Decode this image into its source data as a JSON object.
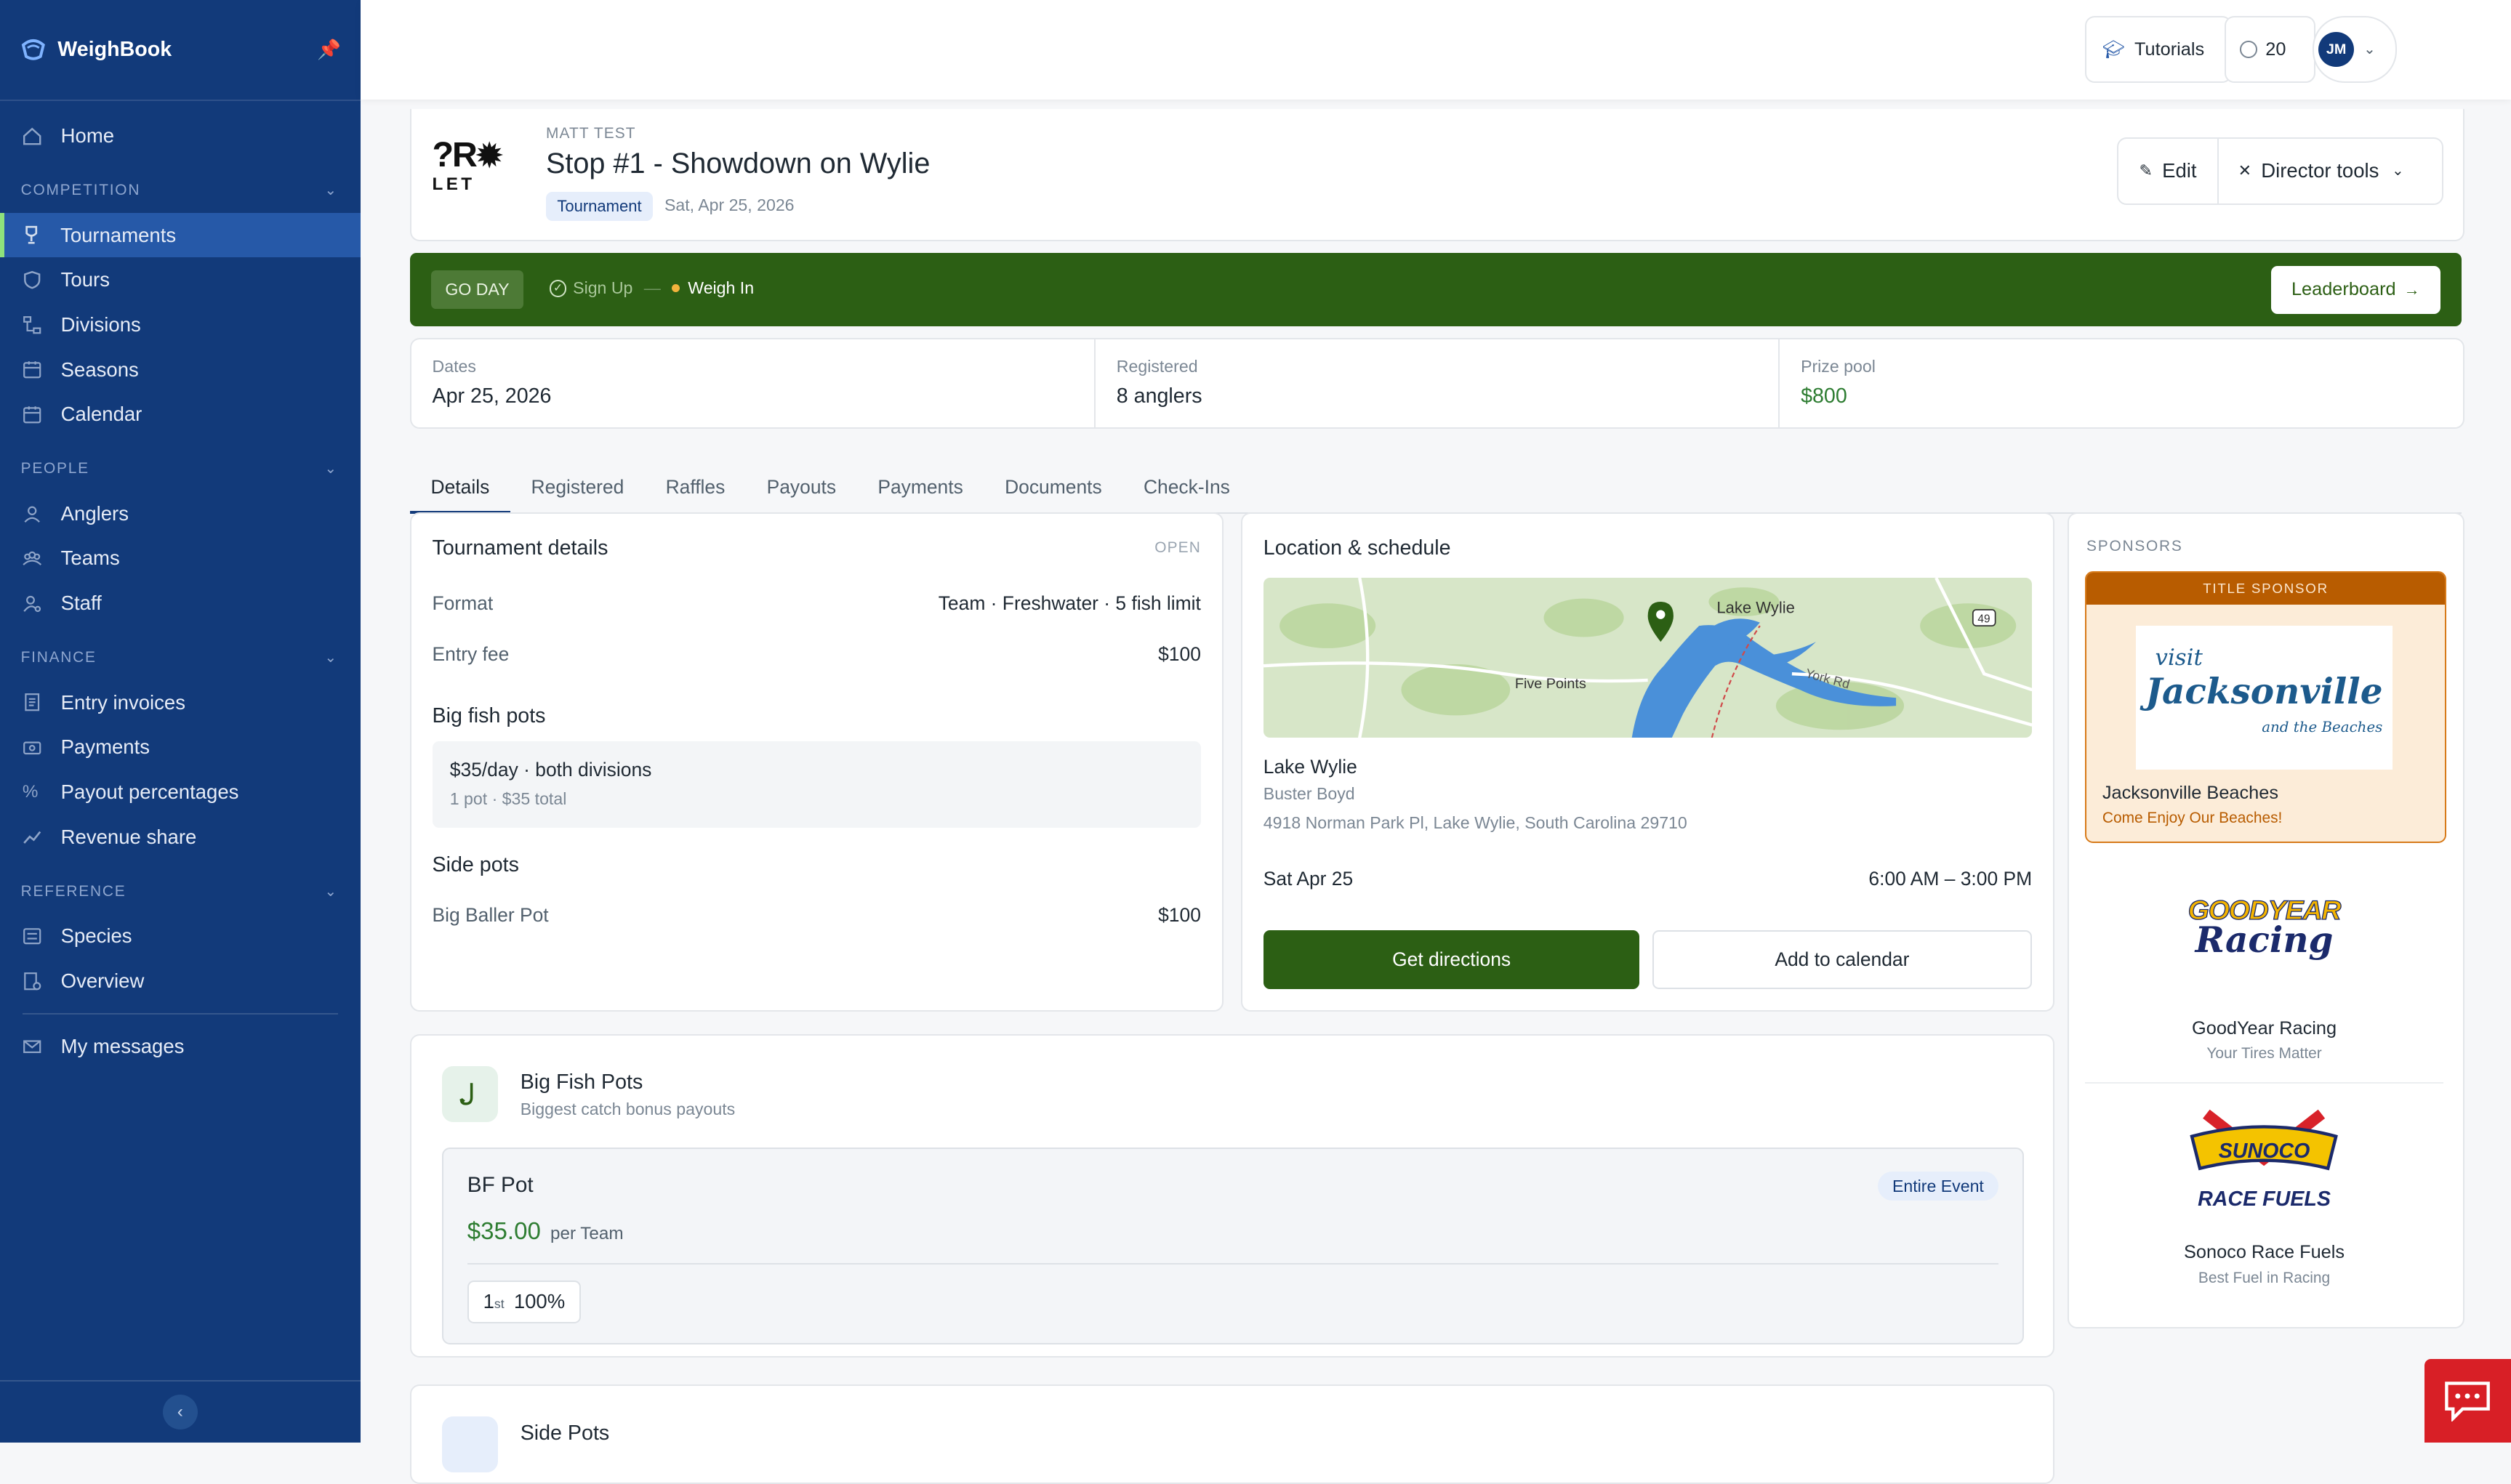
{
  "app": {
    "name": "WeighBook"
  },
  "sidebar": {
    "home": "Home",
    "sections": {
      "competition": "COMPETITION",
      "people": "PEOPLE",
      "finance": "FINANCE",
      "reference": "REFERENCE"
    },
    "competition": [
      "Tournaments",
      "Tours",
      "Divisions",
      "Seasons",
      "Calendar"
    ],
    "people": [
      "Anglers",
      "Teams",
      "Staff"
    ],
    "finance": [
      "Entry invoices",
      "Payments",
      "Payout percentages",
      "Revenue share"
    ],
    "reference": [
      "Species",
      "Overview"
    ],
    "messages": "My messages"
  },
  "topbar": {
    "tutorials": "Tutorials",
    "credits": "20",
    "user_initials": "JM"
  },
  "event": {
    "org": "MATT TEST",
    "title": "Stop #1 - Showdown on Wylie",
    "badge": "Tournament",
    "date": "Sat, Apr 25, 2026",
    "edit": "Edit",
    "director_tools": "Director tools"
  },
  "status_bar": {
    "go_day": "GO DAY",
    "sign_up": "Sign Up",
    "weigh_in": "Weigh In",
    "leaderboard": "Leaderboard"
  },
  "stats": [
    {
      "label": "Dates",
      "value": "Apr 25, 2026"
    },
    {
      "label": "Registered",
      "value": "8 anglers"
    },
    {
      "label": "Prize pool",
      "value": "$800"
    }
  ],
  "tabs": [
    "Details",
    "Registered",
    "Raffles",
    "Payouts",
    "Payments",
    "Documents",
    "Check-Ins"
  ],
  "details": {
    "title": "Tournament details",
    "status": "OPEN",
    "format_label": "Format",
    "format_value": "Team · Freshwater · 5 fish limit",
    "fee_label": "Entry fee",
    "fee_value": "$100",
    "big_fish_title": "Big fish pots",
    "big_fish_main": "$35/day · both divisions",
    "big_fish_sub": "1 pot · $35 total",
    "side_pots_title": "Side pots",
    "side_pot_name": "Big Baller Pot",
    "side_pot_value": "$100"
  },
  "location": {
    "title": "Location & schedule",
    "map_labels": {
      "lake": "Lake Wylie",
      "town": "Five Points",
      "road": "York Rd",
      "route": "49"
    },
    "lake": "Lake Wylie",
    "place": "Buster Boyd",
    "address": "4918 Norman Park Pl, Lake Wylie, South Carolina 29710",
    "day": "Sat Apr 25",
    "time": "6:00 AM – 3:00 PM",
    "directions": "Get directions",
    "calendar": "Add to calendar"
  },
  "sponsors": {
    "title": "SPONSORS",
    "title_sponsor_label": "TITLE SPONSOR",
    "items": [
      {
        "name": "Jacksonville Beaches",
        "tagline": "Come Enjoy Our Beaches!",
        "logo_top": "visit",
        "logo_main": "Jacksonville",
        "logo_sub": "and the Beaches"
      },
      {
        "name": "GoodYear Racing",
        "tagline": "Your Tires Matter",
        "logo_top": "GOODYEAR",
        "logo_main": "Racing"
      },
      {
        "name": "Sonoco Race Fuels",
        "tagline": "Best Fuel in Racing",
        "logo_top": "SUNOCO",
        "logo_main": "RACE FUELS"
      }
    ]
  },
  "big_fish_pots": {
    "title": "Big Fish Pots",
    "subtitle": "Biggest catch bonus payouts",
    "pot_name": "BF Pot",
    "scope": "Entire Event",
    "amount": "$35.00",
    "per": "per Team",
    "place_num": "1",
    "place_suffix": "st",
    "percent": "100%"
  },
  "side_pots_card": {
    "title": "Side Pots"
  },
  "colors": {
    "primary": "#123a7a",
    "accent_green": "#2c5f14",
    "sponsor_orange": "#b85c00",
    "money_green": "#2e7d32"
  }
}
